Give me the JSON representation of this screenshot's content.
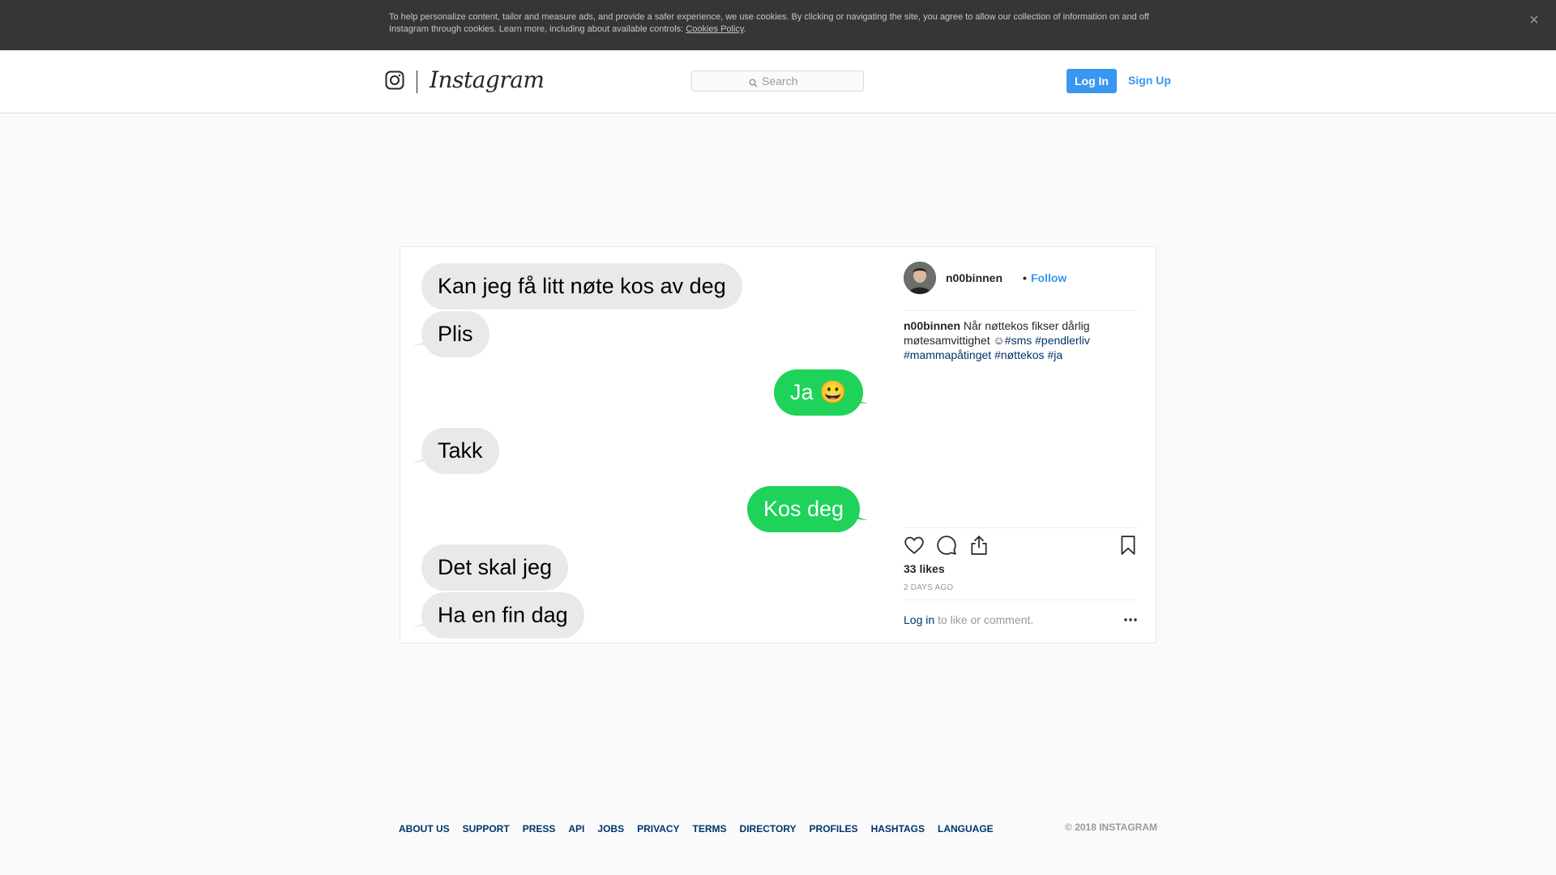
{
  "cookie_banner": {
    "text": "To help personalize content, tailor and measure ads, and provide a safer experience, we use cookies. By clicking or navigating the site, you agree to allow our collection of information on and off Instagram through cookies. Learn more, including about available controls: ",
    "link": "Cookies Policy",
    "suffix": ".",
    "close": "×"
  },
  "header": {
    "wordmark": "Instagram",
    "search_placeholder": "Search",
    "login": "Log In",
    "signup": "Sign Up"
  },
  "post": {
    "messages": [
      {
        "text": "Kan jeg få litt nøte kos av deg",
        "side": "in"
      },
      {
        "text": "Plis",
        "side": "in"
      },
      {
        "text": "Ja 😀",
        "side": "out"
      },
      {
        "text": "Takk",
        "side": "in"
      },
      {
        "text": "Kos deg",
        "side": "out"
      },
      {
        "text": "Det skal jeg",
        "side": "in"
      },
      {
        "text": "Ha en fin dag",
        "side": "in"
      }
    ],
    "username": "n00binnen",
    "follow_dot": "•",
    "follow": "Follow",
    "caption": {
      "user": "n00binnen",
      "text": " Når nøttekos fikser dårlig møtesamvittighet ☺",
      "tags": [
        "#sms",
        "#pendlerliv",
        "#mammapåtinget",
        "#nøttekos",
        "#ja"
      ]
    },
    "likes": "33 likes",
    "time": "2 DAYS AGO",
    "login_link": "Log in",
    "login_suffix": " to like or comment."
  },
  "footer": {
    "links": [
      "ABOUT US",
      "SUPPORT",
      "PRESS",
      "API",
      "JOBS",
      "PRIVACY",
      "TERMS",
      "DIRECTORY",
      "PROFILES",
      "HASHTAGS",
      "LANGUAGE"
    ],
    "copyright": "© 2018 INSTAGRAM"
  },
  "colors": {
    "accent": "#3897f0",
    "link_dark": "#003569",
    "bubble_in": "#e9e9eb",
    "bubble_out": "#1fd25a",
    "banner": "#363636"
  },
  "icons": [
    "instagram-camera-icon",
    "search-icon",
    "close-icon",
    "heart-icon",
    "comment-icon",
    "share-icon",
    "bookmark-icon",
    "more-options-icon"
  ]
}
